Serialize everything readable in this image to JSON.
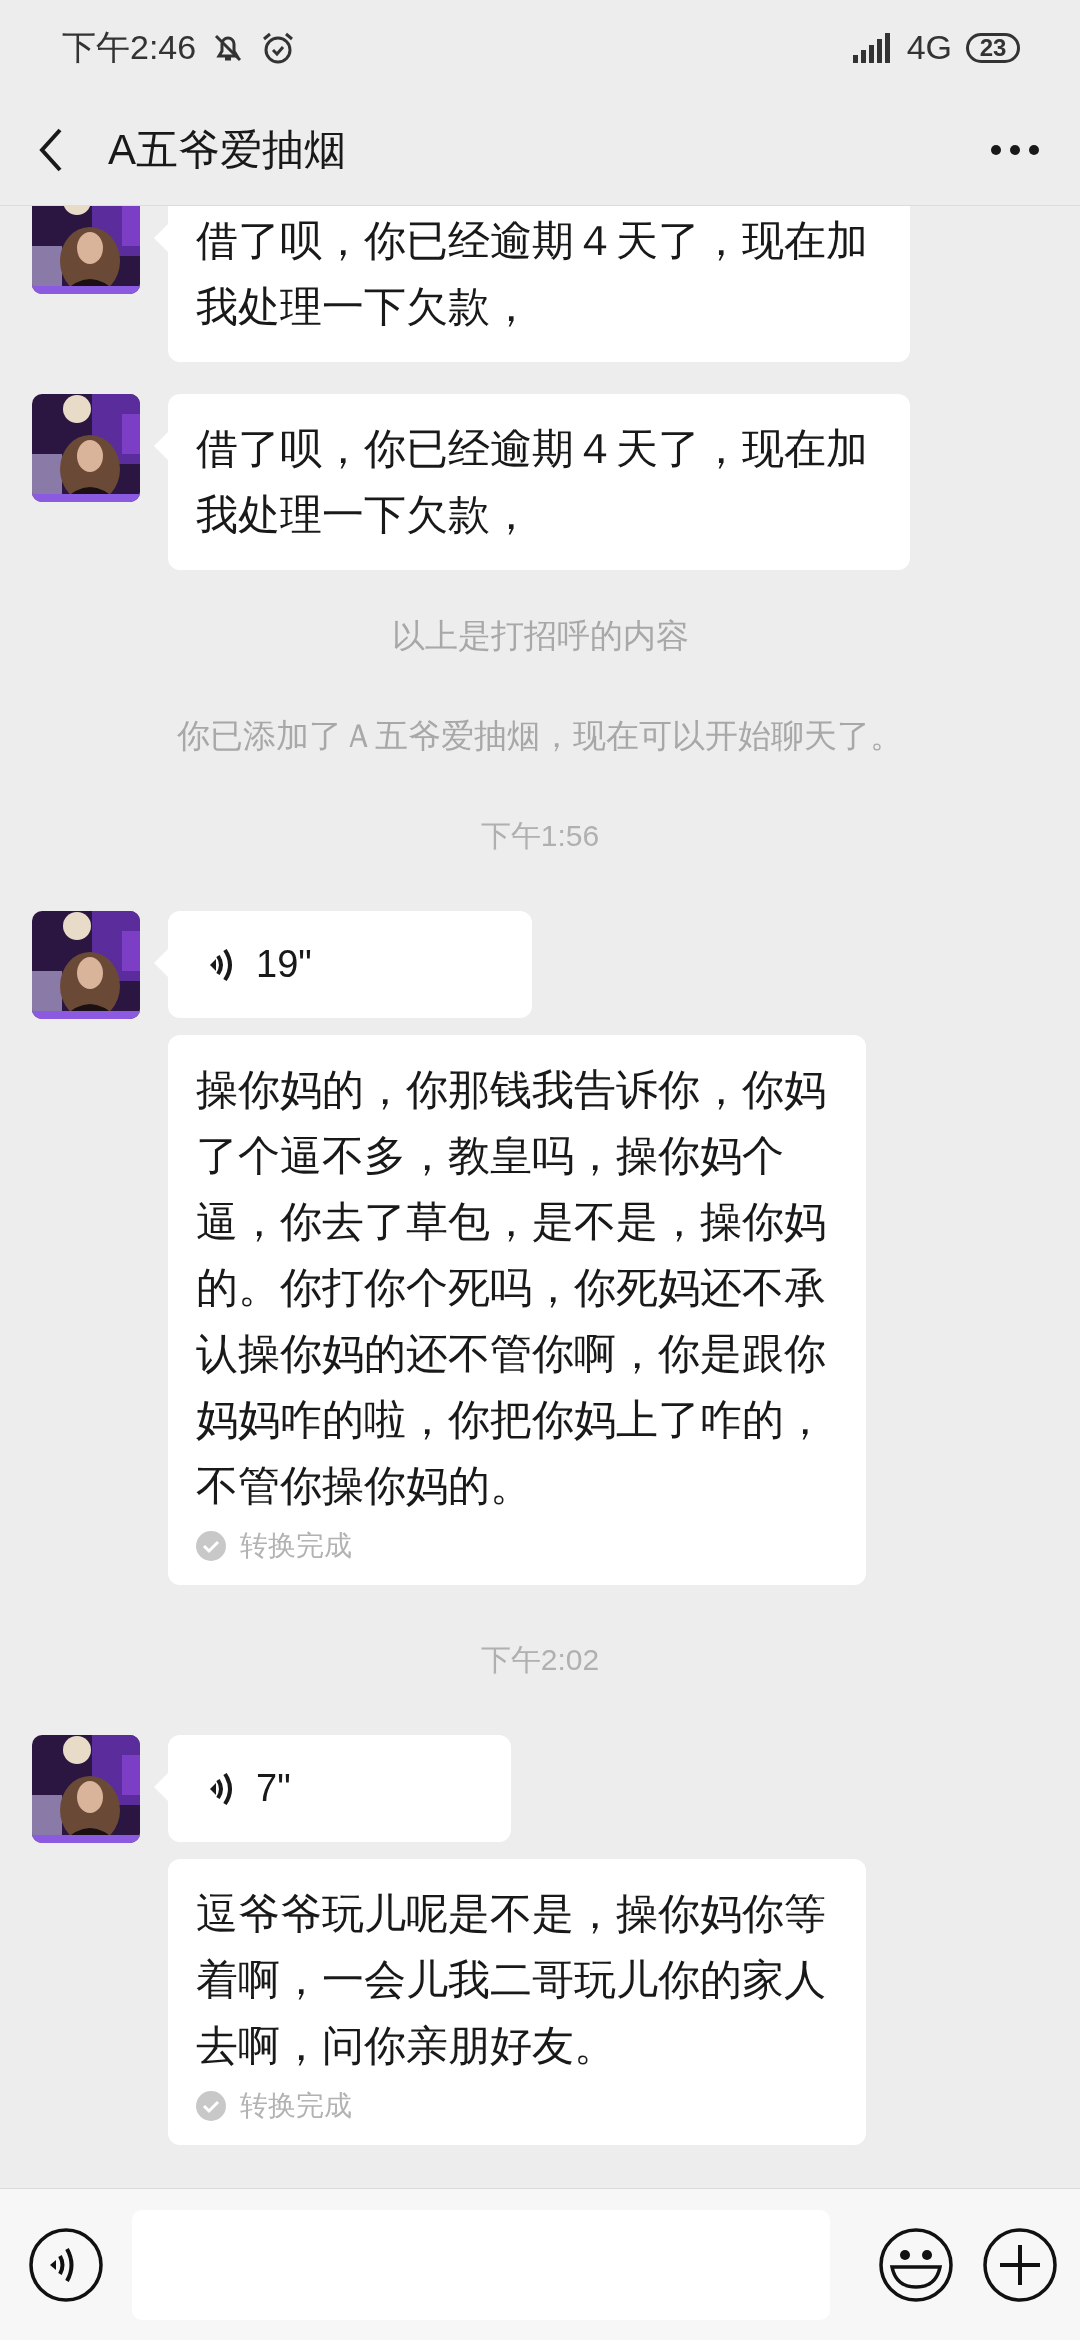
{
  "status_bar": {
    "time": "下午2:46",
    "network": "4G",
    "battery": "23"
  },
  "header": {
    "title": "A五爷爱抽烟"
  },
  "messages": [
    {
      "kind": "text",
      "text": "借了呗，你已经逾期４天了，现在加我处理一下欠款，"
    },
    {
      "kind": "text",
      "text": "借了呗，你已经逾期４天了，现在加我处理一下欠款，"
    },
    {
      "kind": "notice",
      "text": "以上是打招呼的内容"
    },
    {
      "kind": "notice",
      "text": "你已添加了Ａ五爷爱抽烟，现在可以开始聊天了。"
    },
    {
      "kind": "time",
      "text": "下午1:56"
    },
    {
      "kind": "voice",
      "duration": "19\"",
      "transcript": "操你妈的，你那钱我告诉你，你妈了个逼不多，教皇吗，操你妈个逼，你去了草包，是不是，操你妈的。你打你个死吗，你死妈还不承认操你妈的还不管你啊，你是跟你妈妈咋的啦，你把你妈上了咋的，不管你操你妈的。",
      "status": "转换完成"
    },
    {
      "kind": "time",
      "text": "下午2:02"
    },
    {
      "kind": "voice",
      "duration": "7\"",
      "transcript": "逗爷爷玩儿呢是不是，操你妈你等着啊，一会儿我二哥玩儿你的家人去啊，问你亲朋好友。",
      "status": "转换完成"
    }
  ]
}
